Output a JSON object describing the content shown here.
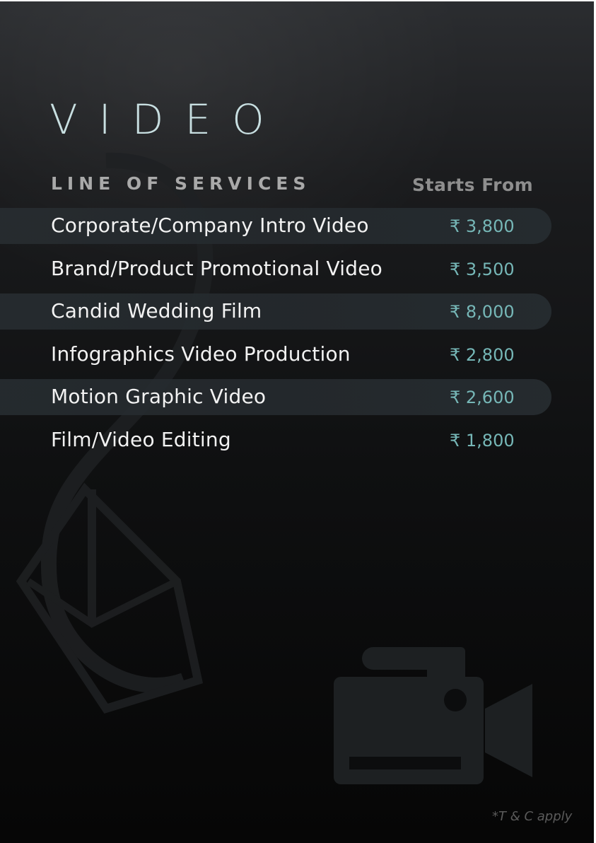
{
  "page": {
    "title": "VIDEO",
    "column_header": "LINE OF SERVICES",
    "price_header": "Starts From",
    "footer_note": "*T & C apply"
  },
  "services": [
    {
      "name": "Corporate/Company Intro Video",
      "price": "₹ 3,800"
    },
    {
      "name": "Brand/Product Promotional Video",
      "price": "₹ 3,500"
    },
    {
      "name": "Candid Wedding Film",
      "price": "₹ 8,000"
    },
    {
      "name": "Infographics Video Production",
      "price": "₹ 2,800"
    },
    {
      "name": "Motion Graphic Video",
      "price": "₹ 2,600"
    },
    {
      "name": "Film/Video Editing",
      "price": "₹ 1,800"
    }
  ],
  "decor": {
    "background_icon": "video-camera-icon",
    "background_logo": "logo-watermark",
    "colors": {
      "title": "#c8dfe1",
      "price": "#76b7b7",
      "row_highlight": "#24292d"
    }
  }
}
